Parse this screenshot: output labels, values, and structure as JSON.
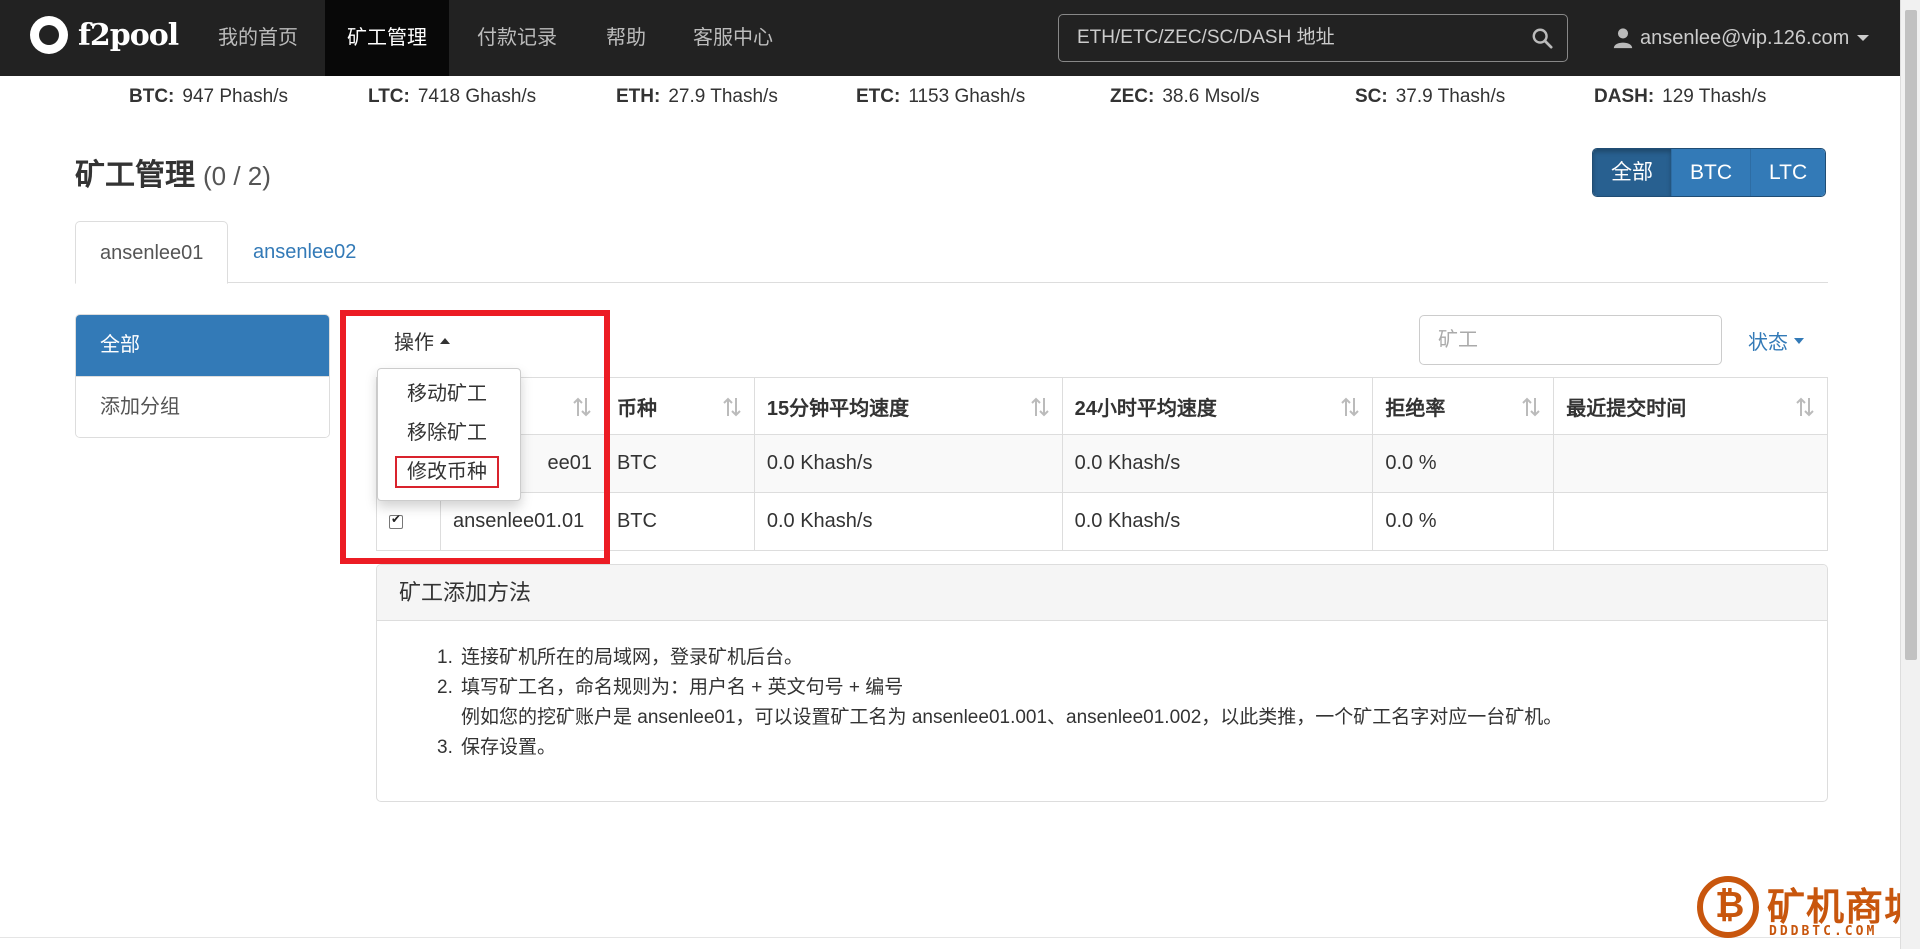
{
  "nav": {
    "brand": "f2pool",
    "items": [
      "我的首页",
      "矿工管理",
      "付款记录",
      "帮助",
      "客服中心"
    ],
    "search_placeholder": "ETH/ETC/ZEC/SC/DASH 地址",
    "user": "ansenlee@vip.126.com"
  },
  "stats": [
    {
      "coin": "BTC:",
      "value": "947 Phash/s"
    },
    {
      "coin": "LTC:",
      "value": "7418 Ghash/s"
    },
    {
      "coin": "ETH:",
      "value": "27.9 Thash/s"
    },
    {
      "coin": "ETC:",
      "value": "1153 Ghash/s"
    },
    {
      "coin": "ZEC:",
      "value": "38.6 Msol/s"
    },
    {
      "coin": "SC:",
      "value": "37.9 Thash/s"
    },
    {
      "coin": "DASH:",
      "value": "129 Thash/s"
    }
  ],
  "page": {
    "title": "矿工管理",
    "count": "(0 / 2)",
    "coin_filters": [
      "全部",
      "BTC",
      "LTC"
    ]
  },
  "tabs": [
    "ansenlee01",
    "ansenlee02"
  ],
  "sidebar": [
    "全部",
    "添加分组"
  ],
  "toolbar": {
    "operation": "操作",
    "miner_placeholder": "矿工",
    "status": "状态"
  },
  "dropdown": [
    "移动矿工",
    "移除矿工",
    "修改币种"
  ],
  "table": {
    "headers": [
      "币种",
      "15分钟平均速度",
      "24小时平均速度",
      "拒绝率",
      "最近提交时间"
    ],
    "rows": [
      {
        "name": "ee01",
        "coin": "BTC",
        "speed15": "0.0 Khash/s",
        "speed24": "0.0 Khash/s",
        "reject": "0.0 %",
        "last": ""
      },
      {
        "name": "ansenlee01.01",
        "coin": "BTC",
        "speed15": "0.0 Khash/s",
        "speed24": "0.0 Khash/s",
        "reject": "0.0 %",
        "last": ""
      }
    ]
  },
  "howto": {
    "title": "矿工添加方法",
    "steps": [
      "连接矿机所在的局域网，登录矿机后台。",
      "填写矿工名，命名规则为：用户名 + 英文句号 + 编号",
      "保存设置。"
    ],
    "example": "例如您的挖矿账户是 ansenlee01，可以设置矿工名为 ansenlee01.001、ansenlee01.002，以此类推，一个矿工名字对应一台矿机。"
  },
  "watermark": {
    "title": "矿机商城",
    "sub": "DDDBTC.COM"
  },
  "colors": {
    "navbar": "#222222",
    "primary": "#337ab7",
    "highlight": "#ec1c24",
    "watermark": "#c8560d"
  }
}
